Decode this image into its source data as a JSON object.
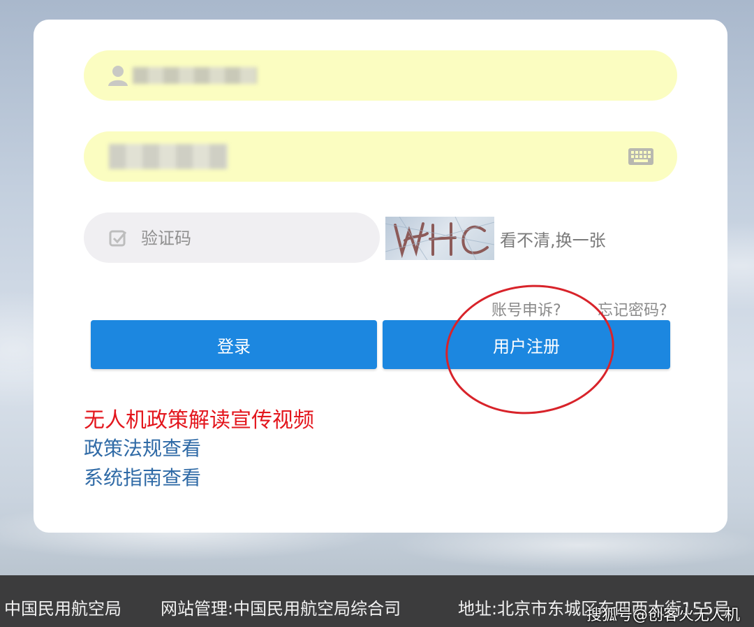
{
  "login_form": {
    "username": {
      "value": "",
      "icon": "person-icon"
    },
    "password": {
      "value": "",
      "icon": "keyboard-icon"
    },
    "captcha": {
      "placeholder": "验证码",
      "icon": "checkbox-icon"
    },
    "captcha_refresh": "看不清,换一张",
    "appeal_link": "账号申诉?",
    "forgot_link": "忘记密码?",
    "login_button": "登录",
    "register_button": "用户注册"
  },
  "links": {
    "video": "无人机政策解读宣传视频",
    "policy": "政策法规查看",
    "guide": "系统指南查看"
  },
  "footer": {
    "organizer": "中国民用航空局",
    "management": "网站管理:中国民用航空局综合司",
    "address": "地址:北京市东城区东四西大街155号"
  },
  "watermark": "搜狐号@创客火无人机",
  "colors": {
    "button": "#1c87e0",
    "field_autofill": "#fbfdc1",
    "highlight_link": "#e3161d",
    "link": "#2f6aa6",
    "footer_bg": "#3c3c3d",
    "annotation_circle": "#d8232a"
  }
}
